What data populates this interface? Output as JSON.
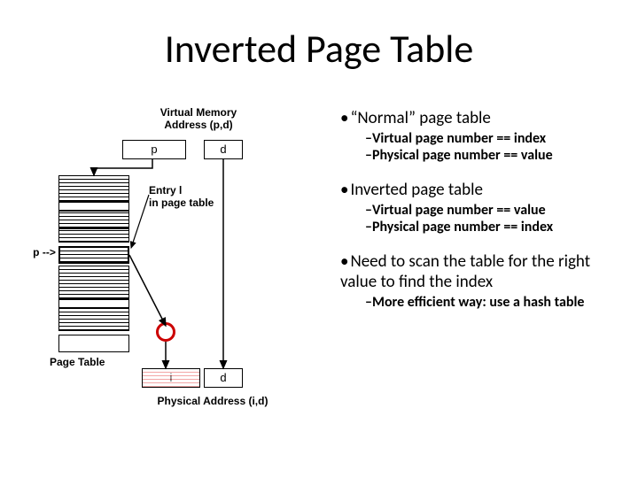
{
  "title": "Inverted Page Table",
  "bullets": {
    "normal": {
      "heading": "“Normal” page table",
      "sub1": "Virtual page number == index",
      "sub2": "Physical page number == value"
    },
    "inverted": {
      "heading": "Inverted page table",
      "sub1": "Virtual page number == value",
      "sub2": "Physical page number == index"
    },
    "scan": {
      "heading": "Need to scan the table for the right value to find the index",
      "sub1": "More efficient way: use a hash table"
    }
  },
  "diagram": {
    "vma_label": "Virtual Memory\nAddress (p,d)",
    "p": "p",
    "d_top": "d",
    "entry_label": "Entry l\nin page table",
    "p_arrow": "p -->",
    "page_table_label": "Page Table",
    "i": "i",
    "d_bottom": "d",
    "phys_label": "Physical Address (i,d)"
  }
}
